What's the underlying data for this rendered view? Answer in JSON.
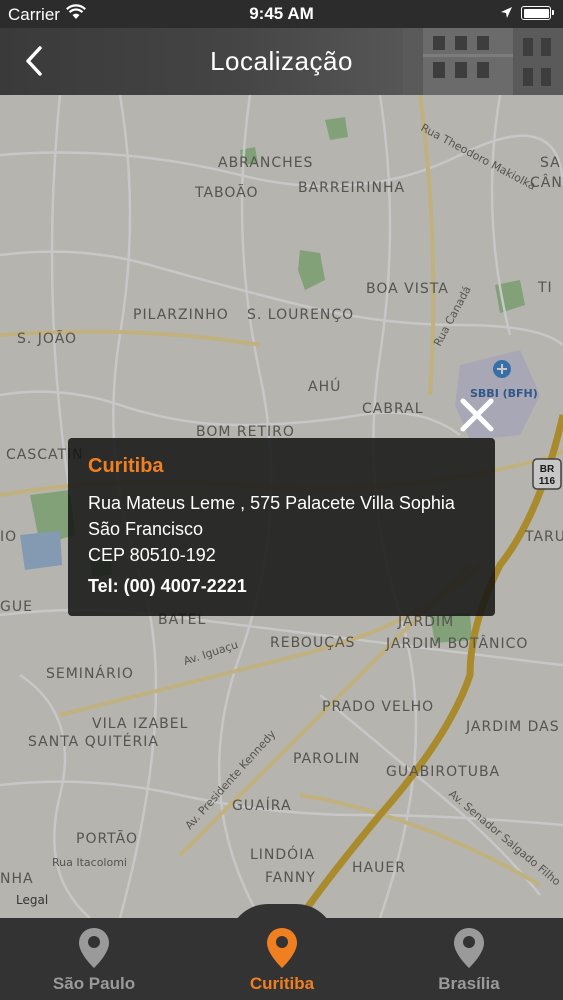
{
  "status_bar": {
    "carrier": "Carrier",
    "time": "9:45 AM"
  },
  "nav": {
    "title": "Localização",
    "back_icon": "chevron-left-icon"
  },
  "map": {
    "labels": {
      "abranches": "ABRANCHES",
      "taboao": "TABOÃO",
      "barreirinha": "BARREIRINHA",
      "theodoro": "Rua Theodoro Makiolka",
      "sa": "SA",
      "can": "CÂN",
      "boa_vista": "BOA VISTA",
      "ti": "TI",
      "pilarzinho": "PILARZINHO",
      "s_lourenco": "S. LOURENÇO",
      "canada": "Rua Canadá",
      "s_joao": "S. JOÃO",
      "ahu": "AHÚ",
      "sbbi": "SBBI (BFH)",
      "cabral": "CABRAL",
      "bom_retiro": "BOM RETIRO",
      "cascatinha": "CASCATIN",
      "br116": "BR 116",
      "io": "IO",
      "taru": "TARU",
      "gue": "GUE",
      "batel": "BATEL",
      "reboucas": "REBOUÇAS",
      "jardim_botanico": "JARDIM BOTÂNICO",
      "seminario": "SEMINÁRIO",
      "iguacu": "Av. Iguaçu",
      "vila_izabel": "VILA IZABEL",
      "prado_velho": "PRADO VELHO",
      "jardim_americas": "JARDIM DAS AMÉRICAS",
      "santa_quiteria": "SANTA QUITÉRIA",
      "kennedy": "Av. Presidente Kennedy",
      "parolin": "PAROLIN",
      "guabirotuba": "GUABIROTUBA",
      "guaira": "GUAÍRA",
      "salgado": "Av. Senador Salgado Filho",
      "portao": "PORTÃO",
      "lindoia": "LINDÓIA",
      "itacolomi": "Rua Itacolomi",
      "hauer": "HAUER",
      "nha": "NHA",
      "fanny": "FANNY",
      "legal": "Legal",
      "br": "BR"
    }
  },
  "popup": {
    "city": "Curitiba",
    "address_line1": "Rua Mateus Leme , 575 Palacete Villa Sophia",
    "address_line2": "São Francisco",
    "address_line3": "CEP 80510-192",
    "phone": "Tel: (00) 4007-2221"
  },
  "tabs": [
    {
      "label": "São Paulo",
      "icon": "map-pin-icon",
      "active": false
    },
    {
      "label": "Curitiba",
      "icon": "map-pin-icon",
      "active": true
    },
    {
      "label": "Brasília",
      "icon": "map-pin-icon",
      "active": false
    }
  ],
  "colors": {
    "accent": "#f07f22",
    "tab_inactive": "#9a9a9a",
    "bar_bg": "#333333"
  }
}
